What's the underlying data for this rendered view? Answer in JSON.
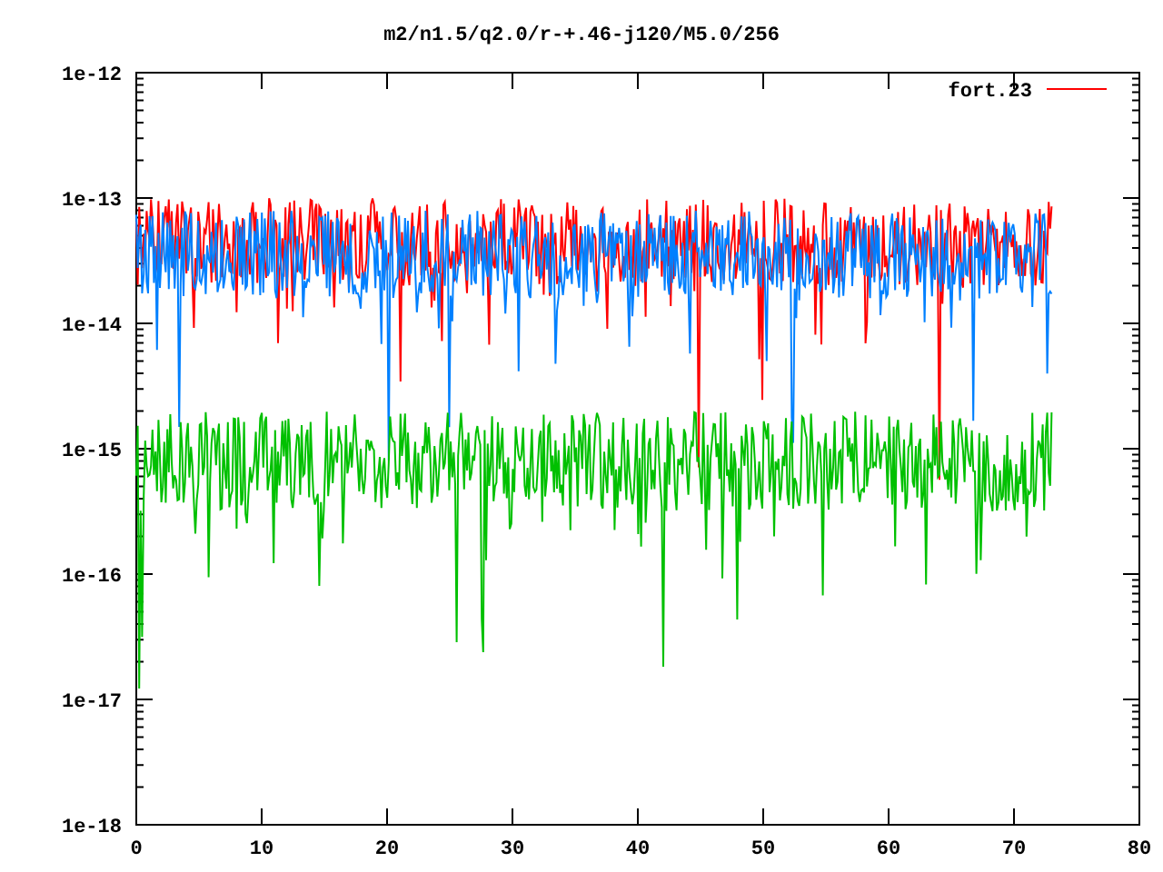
{
  "plot": {
    "title": "m2/n1.5/q2.0/r-+.46-j120/M5.0/256",
    "y_axis_labels": [
      "1e-12",
      "1e-13",
      "1e-14",
      "1e-15",
      "1e-16",
      "1e-17",
      "1e-18"
    ],
    "x_axis_labels": [
      "0",
      "10",
      "20",
      "30",
      "40",
      "50",
      "60",
      "70",
      "80"
    ],
    "traces": [
      {
        "label": "fort.23",
        "color": "#ff0000"
      },
      {
        "color": "#0080ff"
      },
      {
        "color": "#00c000"
      }
    ]
  }
}
